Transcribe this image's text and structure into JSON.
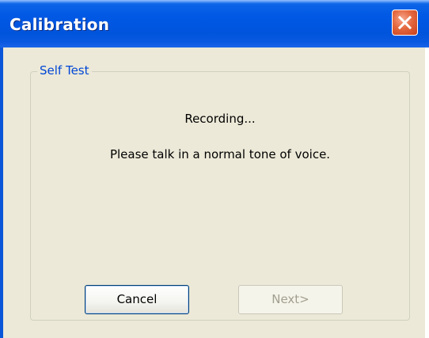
{
  "window": {
    "title": "Calibration",
    "close_icon": "close-icon"
  },
  "groupbox": {
    "label": "Self Test",
    "status": "Recording...",
    "instruction": "Please talk in a normal tone of voice."
  },
  "buttons": {
    "cancel": "Cancel",
    "next": "Next>"
  },
  "colors": {
    "titlebar": "#0054dc",
    "client": "#ece9d8",
    "group_label": "#0046d5",
    "close_button": "#e4683f",
    "disabled_text": "#a19f8f"
  }
}
